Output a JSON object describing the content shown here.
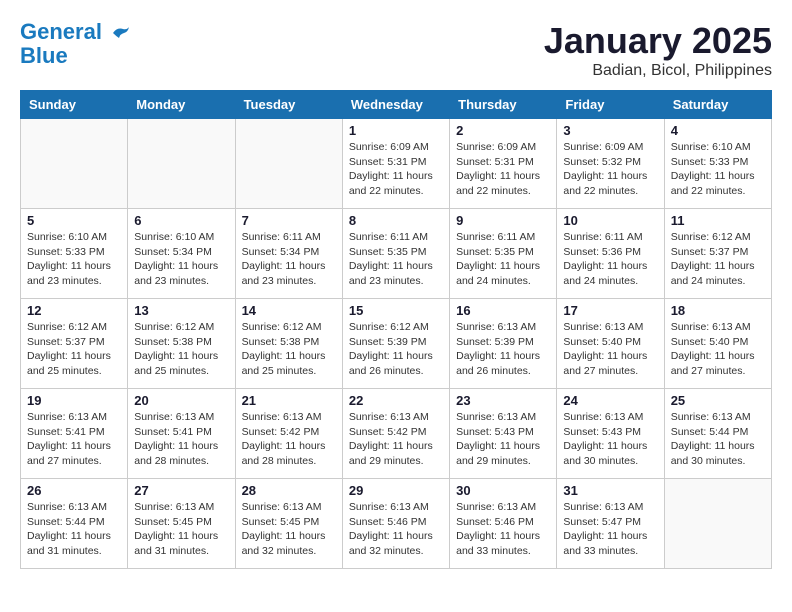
{
  "logo": {
    "line1": "General",
    "line2": "Blue"
  },
  "title": {
    "month": "January 2025",
    "location": "Badian, Bicol, Philippines"
  },
  "headers": [
    "Sunday",
    "Monday",
    "Tuesday",
    "Wednesday",
    "Thursday",
    "Friday",
    "Saturday"
  ],
  "weeks": [
    [
      {
        "day": "",
        "info": ""
      },
      {
        "day": "",
        "info": ""
      },
      {
        "day": "",
        "info": ""
      },
      {
        "day": "1",
        "info": "Sunrise: 6:09 AM\nSunset: 5:31 PM\nDaylight: 11 hours\nand 22 minutes."
      },
      {
        "day": "2",
        "info": "Sunrise: 6:09 AM\nSunset: 5:31 PM\nDaylight: 11 hours\nand 22 minutes."
      },
      {
        "day": "3",
        "info": "Sunrise: 6:09 AM\nSunset: 5:32 PM\nDaylight: 11 hours\nand 22 minutes."
      },
      {
        "day": "4",
        "info": "Sunrise: 6:10 AM\nSunset: 5:33 PM\nDaylight: 11 hours\nand 22 minutes."
      }
    ],
    [
      {
        "day": "5",
        "info": "Sunrise: 6:10 AM\nSunset: 5:33 PM\nDaylight: 11 hours\nand 23 minutes."
      },
      {
        "day": "6",
        "info": "Sunrise: 6:10 AM\nSunset: 5:34 PM\nDaylight: 11 hours\nand 23 minutes."
      },
      {
        "day": "7",
        "info": "Sunrise: 6:11 AM\nSunset: 5:34 PM\nDaylight: 11 hours\nand 23 minutes."
      },
      {
        "day": "8",
        "info": "Sunrise: 6:11 AM\nSunset: 5:35 PM\nDaylight: 11 hours\nand 23 minutes."
      },
      {
        "day": "9",
        "info": "Sunrise: 6:11 AM\nSunset: 5:35 PM\nDaylight: 11 hours\nand 24 minutes."
      },
      {
        "day": "10",
        "info": "Sunrise: 6:11 AM\nSunset: 5:36 PM\nDaylight: 11 hours\nand 24 minutes."
      },
      {
        "day": "11",
        "info": "Sunrise: 6:12 AM\nSunset: 5:37 PM\nDaylight: 11 hours\nand 24 minutes."
      }
    ],
    [
      {
        "day": "12",
        "info": "Sunrise: 6:12 AM\nSunset: 5:37 PM\nDaylight: 11 hours\nand 25 minutes."
      },
      {
        "day": "13",
        "info": "Sunrise: 6:12 AM\nSunset: 5:38 PM\nDaylight: 11 hours\nand 25 minutes."
      },
      {
        "day": "14",
        "info": "Sunrise: 6:12 AM\nSunset: 5:38 PM\nDaylight: 11 hours\nand 25 minutes."
      },
      {
        "day": "15",
        "info": "Sunrise: 6:12 AM\nSunset: 5:39 PM\nDaylight: 11 hours\nand 26 minutes."
      },
      {
        "day": "16",
        "info": "Sunrise: 6:13 AM\nSunset: 5:39 PM\nDaylight: 11 hours\nand 26 minutes."
      },
      {
        "day": "17",
        "info": "Sunrise: 6:13 AM\nSunset: 5:40 PM\nDaylight: 11 hours\nand 27 minutes."
      },
      {
        "day": "18",
        "info": "Sunrise: 6:13 AM\nSunset: 5:40 PM\nDaylight: 11 hours\nand 27 minutes."
      }
    ],
    [
      {
        "day": "19",
        "info": "Sunrise: 6:13 AM\nSunset: 5:41 PM\nDaylight: 11 hours\nand 27 minutes."
      },
      {
        "day": "20",
        "info": "Sunrise: 6:13 AM\nSunset: 5:41 PM\nDaylight: 11 hours\nand 28 minutes."
      },
      {
        "day": "21",
        "info": "Sunrise: 6:13 AM\nSunset: 5:42 PM\nDaylight: 11 hours\nand 28 minutes."
      },
      {
        "day": "22",
        "info": "Sunrise: 6:13 AM\nSunset: 5:42 PM\nDaylight: 11 hours\nand 29 minutes."
      },
      {
        "day": "23",
        "info": "Sunrise: 6:13 AM\nSunset: 5:43 PM\nDaylight: 11 hours\nand 29 minutes."
      },
      {
        "day": "24",
        "info": "Sunrise: 6:13 AM\nSunset: 5:43 PM\nDaylight: 11 hours\nand 30 minutes."
      },
      {
        "day": "25",
        "info": "Sunrise: 6:13 AM\nSunset: 5:44 PM\nDaylight: 11 hours\nand 30 minutes."
      }
    ],
    [
      {
        "day": "26",
        "info": "Sunrise: 6:13 AM\nSunset: 5:44 PM\nDaylight: 11 hours\nand 31 minutes."
      },
      {
        "day": "27",
        "info": "Sunrise: 6:13 AM\nSunset: 5:45 PM\nDaylight: 11 hours\nand 31 minutes."
      },
      {
        "day": "28",
        "info": "Sunrise: 6:13 AM\nSunset: 5:45 PM\nDaylight: 11 hours\nand 32 minutes."
      },
      {
        "day": "29",
        "info": "Sunrise: 6:13 AM\nSunset: 5:46 PM\nDaylight: 11 hours\nand 32 minutes."
      },
      {
        "day": "30",
        "info": "Sunrise: 6:13 AM\nSunset: 5:46 PM\nDaylight: 11 hours\nand 33 minutes."
      },
      {
        "day": "31",
        "info": "Sunrise: 6:13 AM\nSunset: 5:47 PM\nDaylight: 11 hours\nand 33 minutes."
      },
      {
        "day": "",
        "info": ""
      }
    ]
  ]
}
